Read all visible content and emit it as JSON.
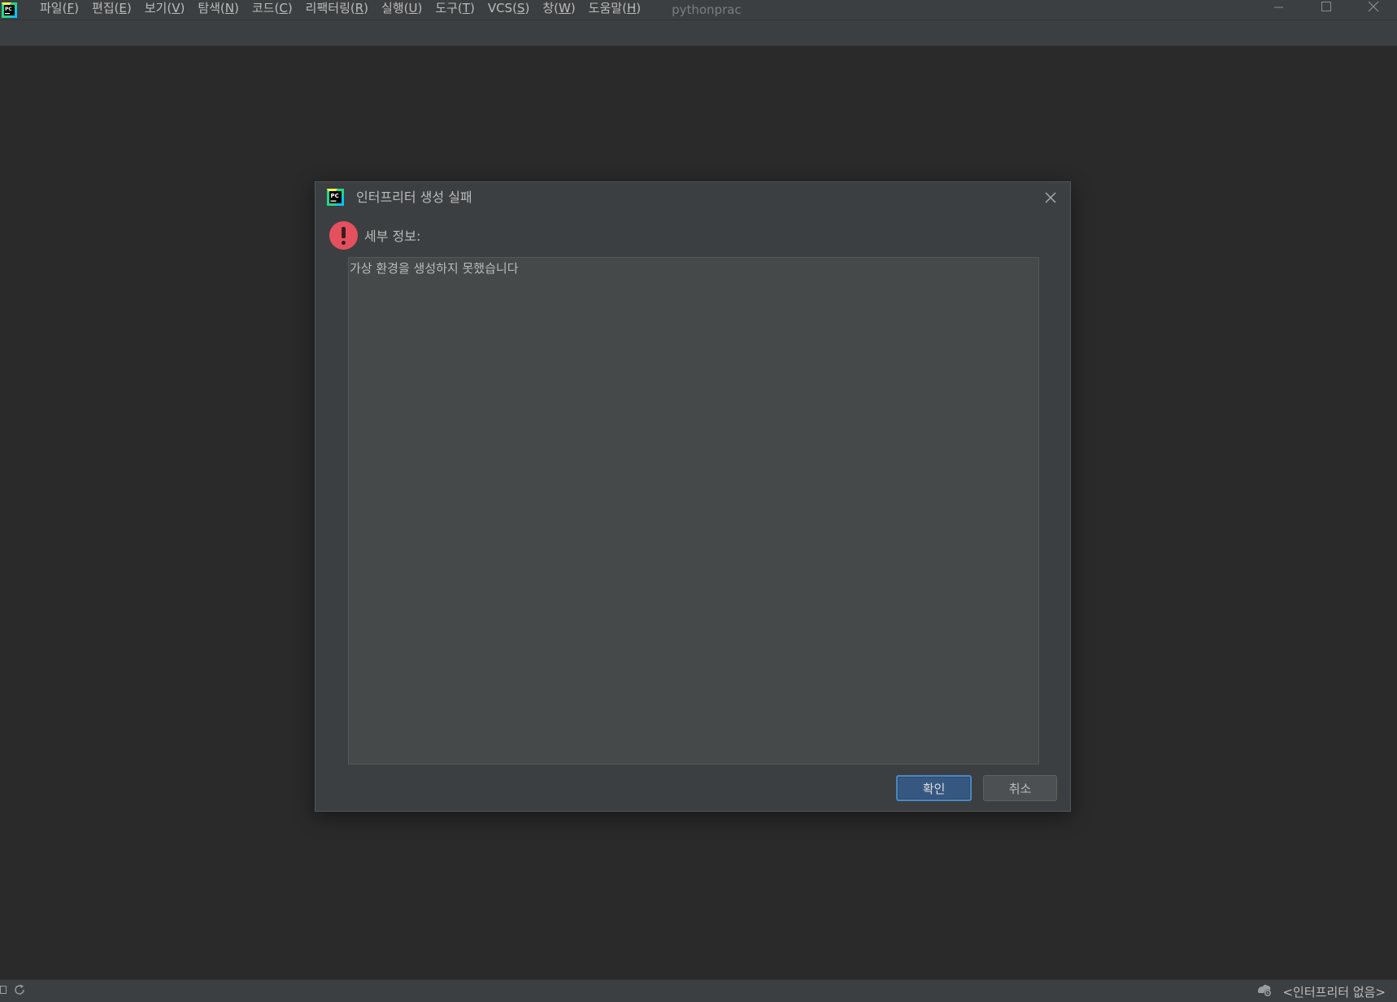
{
  "menu": {
    "items": [
      {
        "label": "파일(",
        "mnemonic": "F",
        "suffix": ")"
      },
      {
        "label": "편집(",
        "mnemonic": "E",
        "suffix": ")"
      },
      {
        "label": "보기(",
        "mnemonic": "V",
        "suffix": ")"
      },
      {
        "label": "탐색(",
        "mnemonic": "N",
        "suffix": ")"
      },
      {
        "label": "코드(",
        "mnemonic": "C",
        "suffix": ")"
      },
      {
        "label": "리팩터링(",
        "mnemonic": "R",
        "suffix": ")"
      },
      {
        "label": "실행(",
        "mnemonic": "U",
        "suffix": ")"
      },
      {
        "label": "도구(",
        "mnemonic": "T",
        "suffix": ")"
      },
      {
        "label": "VCS(",
        "mnemonic": "S",
        "suffix": ")"
      },
      {
        "label": "창(",
        "mnemonic": "W",
        "suffix": ")"
      },
      {
        "label": "도움말(",
        "mnemonic": "H",
        "suffix": ")"
      }
    ],
    "project_title": "pythonprac"
  },
  "dialog": {
    "title": "인터프리터 생성 실패",
    "details_label": "세부 정보:",
    "details_text": "가상 환경을 생성하지 못했습니다",
    "ok_label": "확인",
    "cancel_label": "취소"
  },
  "statusbar": {
    "interpreter_label": "<인터프리터 없음>"
  },
  "icons": {
    "app_logo": "pycharm-logo-icon",
    "dialog_icon": "pycharm-logo-icon",
    "error": "error-icon",
    "close": "close-icon",
    "minimize": "minimize-icon",
    "maximize": "maximize-icon",
    "sync": "sync-icon",
    "settings": "settings-gear-icon"
  },
  "colors": {
    "background": "#2a2a2a",
    "panel": "#3c3f41",
    "text_area": "#45494a",
    "primary_button": "#365880",
    "error_red": "#e5505f"
  }
}
